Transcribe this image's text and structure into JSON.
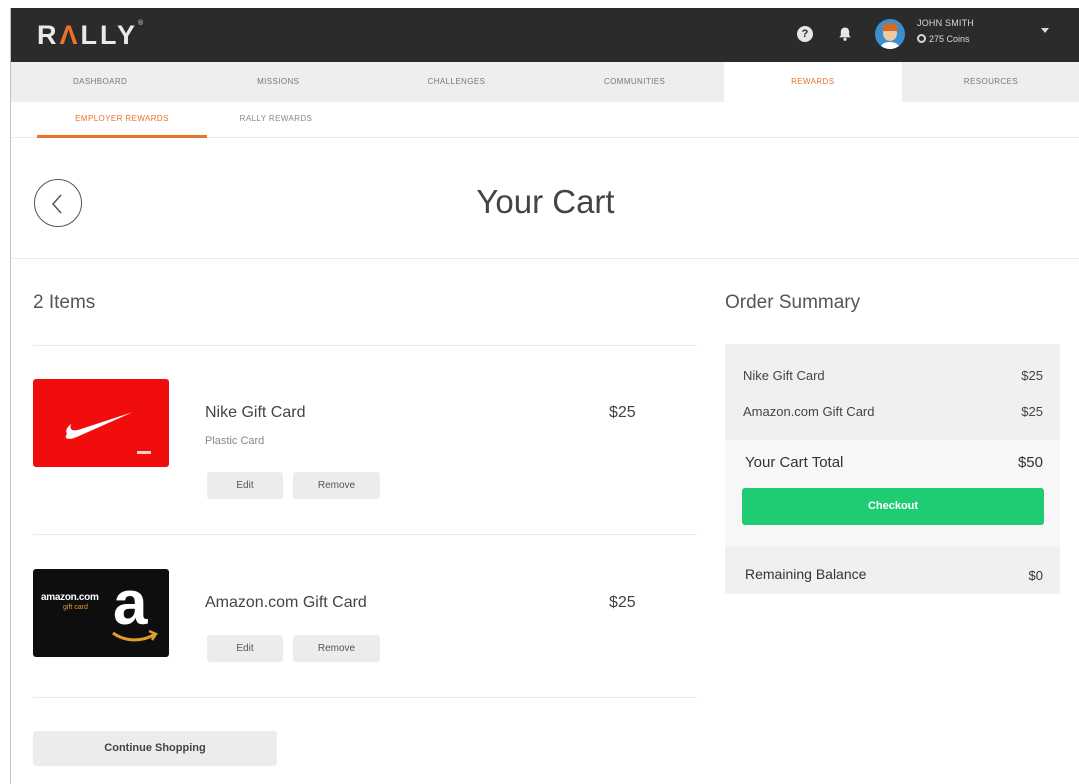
{
  "header": {
    "logo_text": "RALLY",
    "user_name": "JOHN SMITH",
    "coins": "275 Coins",
    "icons": [
      "help-icon",
      "bell-icon",
      "coin-icon",
      "chevron-down-icon"
    ]
  },
  "nav": {
    "tabs": [
      {
        "label": "DASHBOARD"
      },
      {
        "label": "MISSIONS"
      },
      {
        "label": "CHALLENGES"
      },
      {
        "label": "COMMUNITIES"
      },
      {
        "label": "REWARDS"
      },
      {
        "label": "RESOURCES"
      }
    ],
    "active_tab": "REWARDS"
  },
  "subnav": {
    "tabs": [
      {
        "label": "EMPLOYER REWARDS"
      },
      {
        "label": "RALLY REWARDS"
      }
    ],
    "active_tab": "EMPLOYER REWARDS"
  },
  "page": {
    "title": "Your Cart"
  },
  "cart": {
    "count_label": "2 Items",
    "items": [
      {
        "name": "Nike Gift Card",
        "subtitle": "Plastic Card",
        "price": "$25",
        "edit_label": "Edit",
        "remove_label": "Remove"
      },
      {
        "name": "Amazon.com Gift Card",
        "price": "$25",
        "edit_label": "Edit",
        "remove_label": "Remove",
        "card_text": "amazon.com",
        "card_sub": "gift card",
        "card_letter": "a"
      }
    ],
    "continue_label": "Continue Shopping"
  },
  "summary": {
    "title": "Order Summary",
    "lines": [
      {
        "label": "Nike Gift Card",
        "value": "$25"
      },
      {
        "label": "Amazon.com Gift Card",
        "value": "$25"
      }
    ],
    "total_label": "Your Cart Total",
    "total_value": "$50",
    "checkout_label": "Checkout",
    "balance_label": "Remaining Balance",
    "balance_value": "$0"
  },
  "colors": {
    "accent": "#e8742c",
    "checkout": "#1fcc73",
    "header_bg": "#2b2b2b",
    "nike_red": "#f20d0d"
  }
}
